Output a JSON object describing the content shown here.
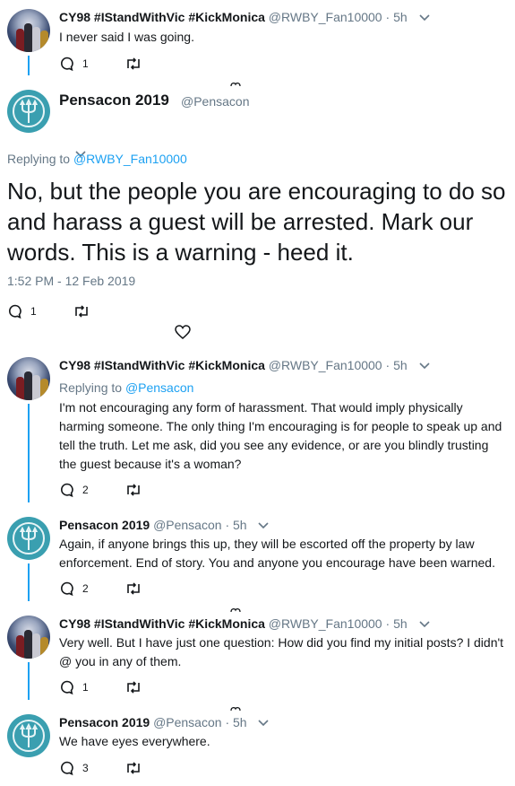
{
  "tweets": [
    {
      "name": "CY98 #IStandWithVic #KickMonica",
      "handle": "@RWBY_Fan10000",
      "dot": "·",
      "time": "5h",
      "text": "I never said I was going.",
      "replies": "1",
      "retweets": ""
    },
    {
      "name": "Pensacon 2019",
      "handle": "@Pensacon",
      "replying_label": "Replying to",
      "replying_to": "@RWBY_Fan10000",
      "text": "No, but the people you are encouraging to do so and harass a guest will be arrested. Mark our words. This is a warning - heed it.",
      "timestamp": "1:52 PM - 12 Feb 2019",
      "replies": "1",
      "retweets": ""
    },
    {
      "name": "CY98 #IStandWithVic #KickMonica",
      "handle": "@RWBY_Fan10000",
      "dot": "·",
      "time": "5h",
      "replying_label": "Replying to",
      "replying_to": "@Pensacon",
      "text": "I'm not encouraging any form of harassment. That would imply physically harming someone. The only thing I'm encouraging is for people to speak up and tell the truth. Let me ask, did you see any evidence, or are you blindly trusting the guest because it's a woman?",
      "replies": "2",
      "retweets": ""
    },
    {
      "name": "Pensacon 2019",
      "handle": "@Pensacon",
      "dot": "·",
      "time": "5h",
      "text": "Again, if anyone brings this up, they will be escorted off the property by law enforcement. End of story. You and anyone you encourage have been warned.",
      "replies": "2",
      "retweets": ""
    },
    {
      "name": "CY98 #IStandWithVic #KickMonica",
      "handle": "@RWBY_Fan10000",
      "dot": "·",
      "time": "5h",
      "text": "Very well. But I have just one question: How did you find my initial posts? I didn't @ you in any of them.",
      "replies": "1",
      "retweets": ""
    },
    {
      "name": "Pensacon 2019",
      "handle": "@Pensacon",
      "dot": "·",
      "time": "5h",
      "text": "We have eyes everywhere.",
      "replies": "3",
      "retweets": ""
    }
  ],
  "icons": {
    "reply": "reply-icon",
    "retweet": "retweet-icon",
    "like": "heart-icon",
    "more": "chevron-down-icon"
  },
  "colors": {
    "link": "#1da1f2",
    "muted": "#657786",
    "text": "#14171a",
    "pensacon_avatar": "#3a9fb0"
  }
}
